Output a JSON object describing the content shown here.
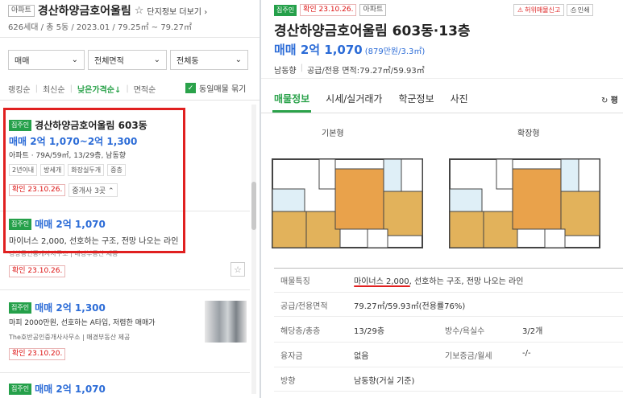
{
  "left": {
    "complex_tag": "아파트",
    "complex_name": "경산하양금호어울림",
    "complex_more": "단지정보 더보기",
    "complex_sub": "626세대 / 총 5동 / 2023.01 / 79.25㎡ ~ 79.27㎡",
    "selects": [
      {
        "label": "매매"
      },
      {
        "label": "전체면적"
      },
      {
        "label": "전체동"
      }
    ],
    "sorts": [
      "랭킹순",
      "최신순",
      "낮은가격순↓",
      "면적순"
    ],
    "same_listing_toggle": "동일매물 묶기",
    "listings": [
      {
        "owner_tag": "집주인",
        "title": "경산하양금호어울림 603동",
        "price": "매매 2억 1,070~2억 1,300",
        "detail": "아파트 · 79A/59㎡, 13/29층, 남동향",
        "features": [
          "2년이내",
          "방세개",
          "화장실두개",
          "중층"
        ],
        "confirm": "확인 23.10.26.",
        "agents": "중개사 3곳"
      },
      {
        "owner_tag": "집주인",
        "price": "매매 2억 1,070",
        "desc": "마이너스 2,000, 선호하는 구조, 전망 나오는 라인",
        "provider": "경상공인중개사사무소 | 매경부동산 제공",
        "confirm": "확인 23.10.26."
      },
      {
        "owner_tag": "집주인",
        "price": "매매 2억 1,300",
        "desc": "마피 2000만원, 선호하는 A타입, 저렴한 매매가",
        "provider": "The호반공인중개사사무소 | 매경부동산 제공",
        "confirm": "확인 23.10.20."
      },
      {
        "owner_tag": "집주인",
        "price": "매매 2억 1,070"
      }
    ]
  },
  "right": {
    "owner_tag": "집주인",
    "confirm": "확인 23.10.26.",
    "type_tag": "아파트",
    "report_btn": "허위매물신고",
    "print_btn": "인쇄",
    "title": "경산하양금호어울림 603동·13층",
    "price": "매매 2억 1,070",
    "price_per": "(879만원/3.3㎡)",
    "direction": "남동향",
    "area": "공급/전용 면적:79.27㎡/59.93㎡",
    "tabs": [
      "매물정보",
      "시세/실거래가",
      "학군정보",
      "사진"
    ],
    "refresh": "평",
    "floorplans": [
      {
        "label": "기본형"
      },
      {
        "label": "확장형"
      }
    ],
    "table": [
      {
        "label": "매물특징",
        "value": "마이너스 2,000, 선호하는 구조, 전망 나오는 라인"
      },
      {
        "label": "공급/전용면적",
        "value": "79.27㎡/59.93㎡(전용률76%)"
      },
      {
        "label": "해당층/총층",
        "value": "13/29층",
        "label2": "방수/욕실수",
        "value2": "3/2개"
      },
      {
        "label": "융자금",
        "value": "없음",
        "label2": "기보증금/월세",
        "value2": "-/-"
      },
      {
        "label": "방향",
        "value": "남동향(거실 기준)"
      }
    ]
  },
  "colors": {
    "accent_green": "#2aa24a",
    "price_blue": "#2c6cd7",
    "highlight_red": "#e02020"
  }
}
